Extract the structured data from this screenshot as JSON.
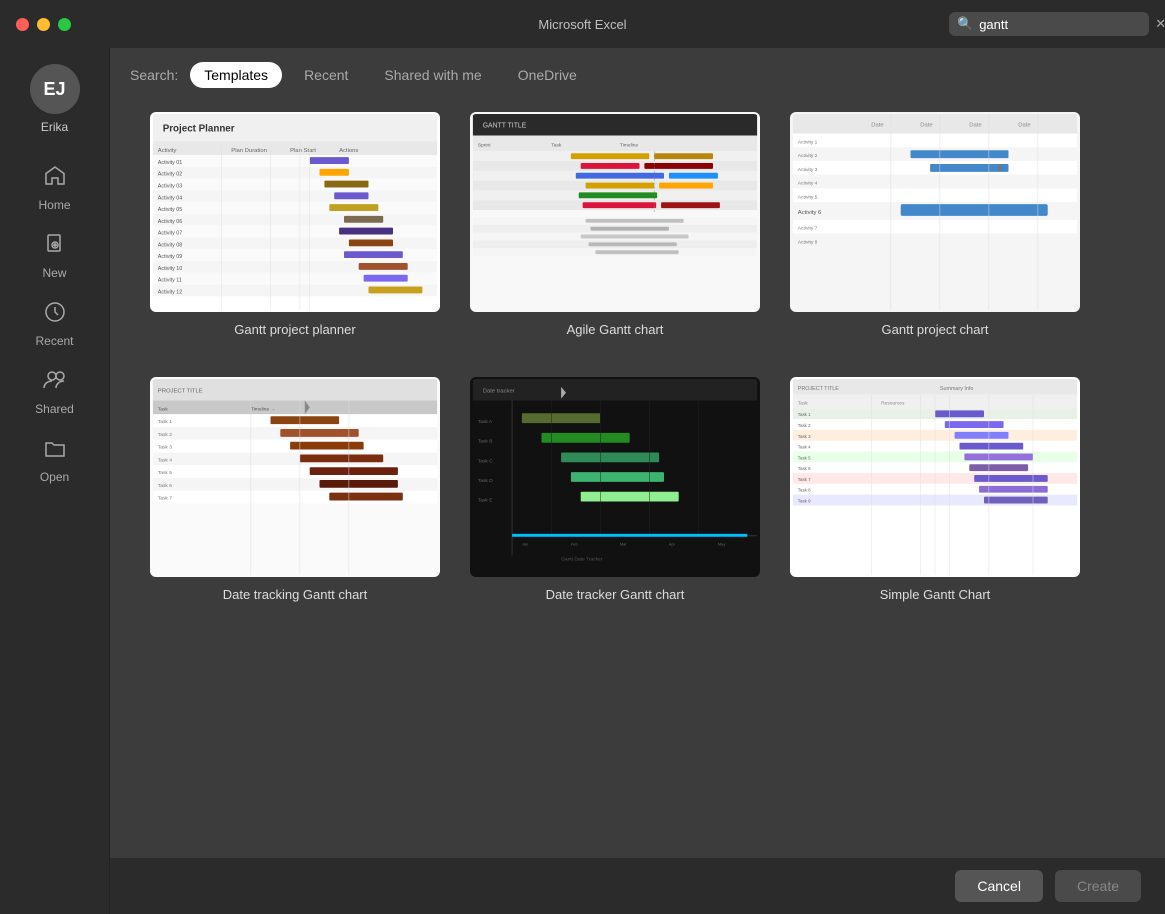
{
  "titleBar": {
    "appName": "Microsoft Excel",
    "searchPlaceholder": "gantt",
    "searchValue": "gantt"
  },
  "sidebar": {
    "avatar": "EJ",
    "userName": "Erika",
    "items": [
      {
        "id": "home",
        "label": "Home",
        "icon": "🏠"
      },
      {
        "id": "new",
        "label": "New",
        "icon": "📄"
      },
      {
        "id": "recent",
        "label": "Recent",
        "icon": "🕐"
      },
      {
        "id": "shared",
        "label": "Shared",
        "icon": "👥"
      },
      {
        "id": "open",
        "label": "Open",
        "icon": "📁"
      }
    ]
  },
  "searchTabs": {
    "label": "Search:",
    "tabs": [
      {
        "id": "templates",
        "label": "Templates",
        "active": true
      },
      {
        "id": "recent",
        "label": "Recent",
        "active": false
      },
      {
        "id": "shared",
        "label": "Shared with me",
        "active": false
      },
      {
        "id": "onedrive",
        "label": "OneDrive",
        "active": false
      }
    ]
  },
  "templates": [
    {
      "id": "gantt-project-planner",
      "name": "Gantt project planner",
      "thumbType": "gantt1"
    },
    {
      "id": "agile-gantt-chart",
      "name": "Agile Gantt chart",
      "thumbType": "gantt2"
    },
    {
      "id": "gantt-project-chart",
      "name": "Gantt project chart",
      "thumbType": "gantt3"
    },
    {
      "id": "date-tracking-gantt",
      "name": "Date tracking Gantt chart",
      "thumbType": "gantt4"
    },
    {
      "id": "date-tracker-gantt",
      "name": "Date tracker Gantt chart",
      "thumbType": "gantt5"
    },
    {
      "id": "simple-gantt",
      "name": "Simple Gantt Chart",
      "thumbType": "gantt6"
    }
  ],
  "footer": {
    "cancelLabel": "Cancel",
    "createLabel": "Create"
  }
}
